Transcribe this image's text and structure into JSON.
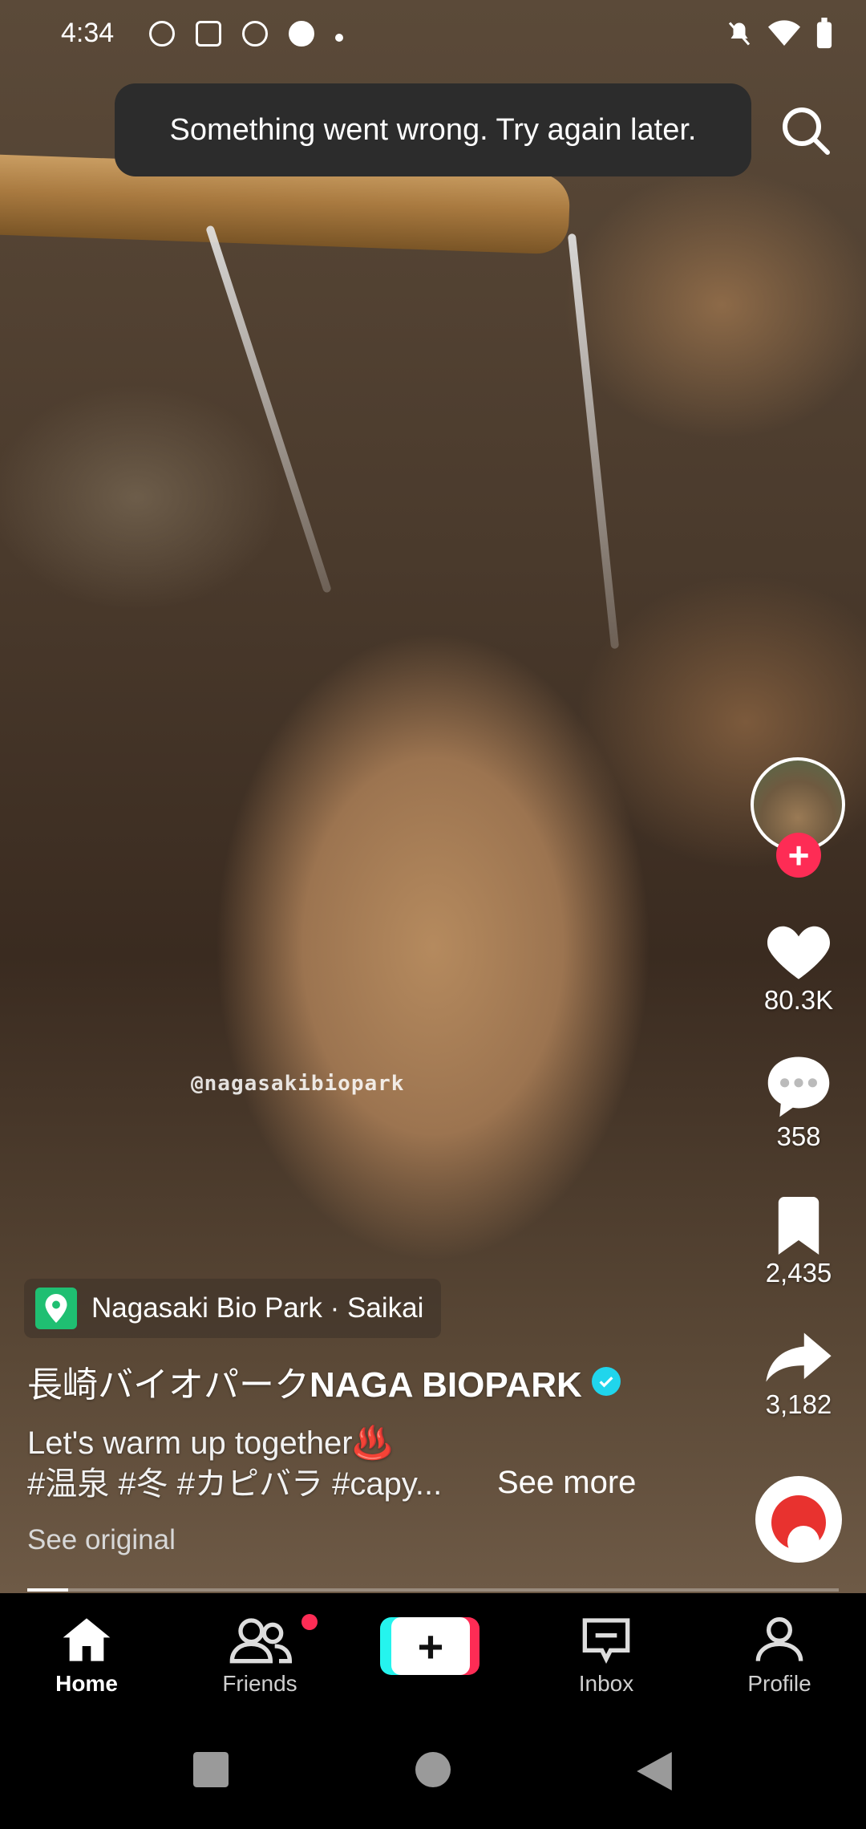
{
  "status_bar": {
    "time": "4:34"
  },
  "toast": {
    "message": "Something went wrong. Try again later."
  },
  "video": {
    "watermark": "@nagasakibiopark"
  },
  "actions": {
    "likes": "80.3K",
    "comments": "358",
    "bookmarks": "2,435",
    "shares": "3,182"
  },
  "post": {
    "location": "Nagasaki Bio Park · Saikai",
    "creator_name_jp": "長崎バイオパーク",
    "creator_name_en": "NAGA BIOPARK",
    "caption_line1": "Let's warm up together♨️",
    "caption_line2": "#温泉 #冬 #カピバラ #capy...",
    "see_more": "See more",
    "see_original": "See original",
    "progress": 0.05
  },
  "nav": {
    "home": "Home",
    "friends": "Friends",
    "inbox": "Inbox",
    "profile": "Profile"
  },
  "colors": {
    "accent": "#fe2c55",
    "cyan": "#25f4ee",
    "verified": "#20d5ec"
  }
}
